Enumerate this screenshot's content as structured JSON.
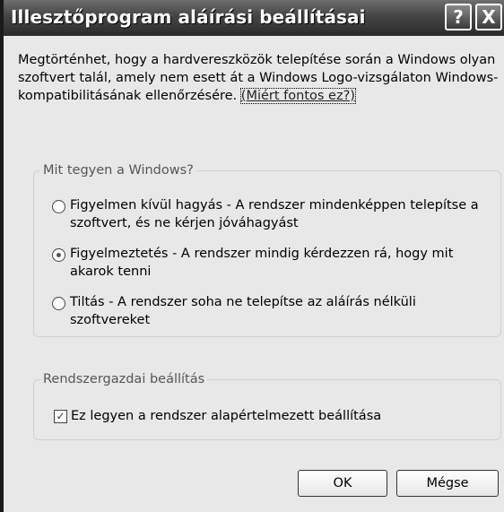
{
  "window": {
    "title": "Illesztőprogram aláírási beállításai",
    "help_glyph": "?",
    "close_glyph": "X"
  },
  "intro": {
    "text": "Megtörténhet, hogy a hardvereszközök telepítése során a Windows olyan szoftvert talál, amely nem esett át a Windows Logo-vizsgálaton Windows-kompatibilitásának ellenőrzésére. ",
    "link": "(Miért fontos ez?)"
  },
  "group_action": {
    "legend": "Mit tegyen a Windows?",
    "options": [
      {
        "label": "Figyelmen kívül hagyás - A rendszer mindenképpen telepítse a szoftvert, és ne kérjen jóváhagyást",
        "selected": false
      },
      {
        "label": "Figyelmeztetés - A rendszer mindig kérdezzen rá, hogy mit akarok tenni",
        "selected": true
      },
      {
        "label": "Tiltás - A rendszer soha ne telepítse az aláírás nélküli szoftvereket",
        "selected": false
      }
    ]
  },
  "group_admin": {
    "legend": "Rendszergazdai beállítás",
    "checkbox_label": "Ez legyen a rendszer alapértelmezett beállítása",
    "checked": true
  },
  "buttons": {
    "ok": "OK",
    "cancel": "Mégse"
  }
}
